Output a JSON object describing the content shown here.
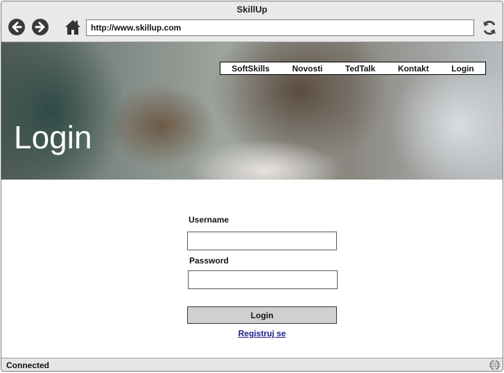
{
  "browser": {
    "title": "SkillUp",
    "url": "http://www.skillup.com",
    "status": "Connected"
  },
  "icons": {
    "back": "back-arrow-icon",
    "forward": "forward-arrow-icon",
    "home": "home-icon",
    "refresh": "refresh-icon",
    "globe": "globe-icon"
  },
  "hero": {
    "title": "Login"
  },
  "nav": {
    "items": [
      {
        "label": "SoftSkills"
      },
      {
        "label": "Novosti"
      },
      {
        "label": "TedTalk"
      },
      {
        "label": "Kontakt"
      },
      {
        "label": "Login"
      }
    ]
  },
  "form": {
    "username_label": "Username",
    "username_value": "",
    "password_label": "Password",
    "password_value": "",
    "submit_label": "Login",
    "register_link": "Registruj se"
  },
  "colors": {
    "link": "#1a1a8a",
    "button": "#d0d0d0",
    "chrome": "#e9e9e9"
  }
}
